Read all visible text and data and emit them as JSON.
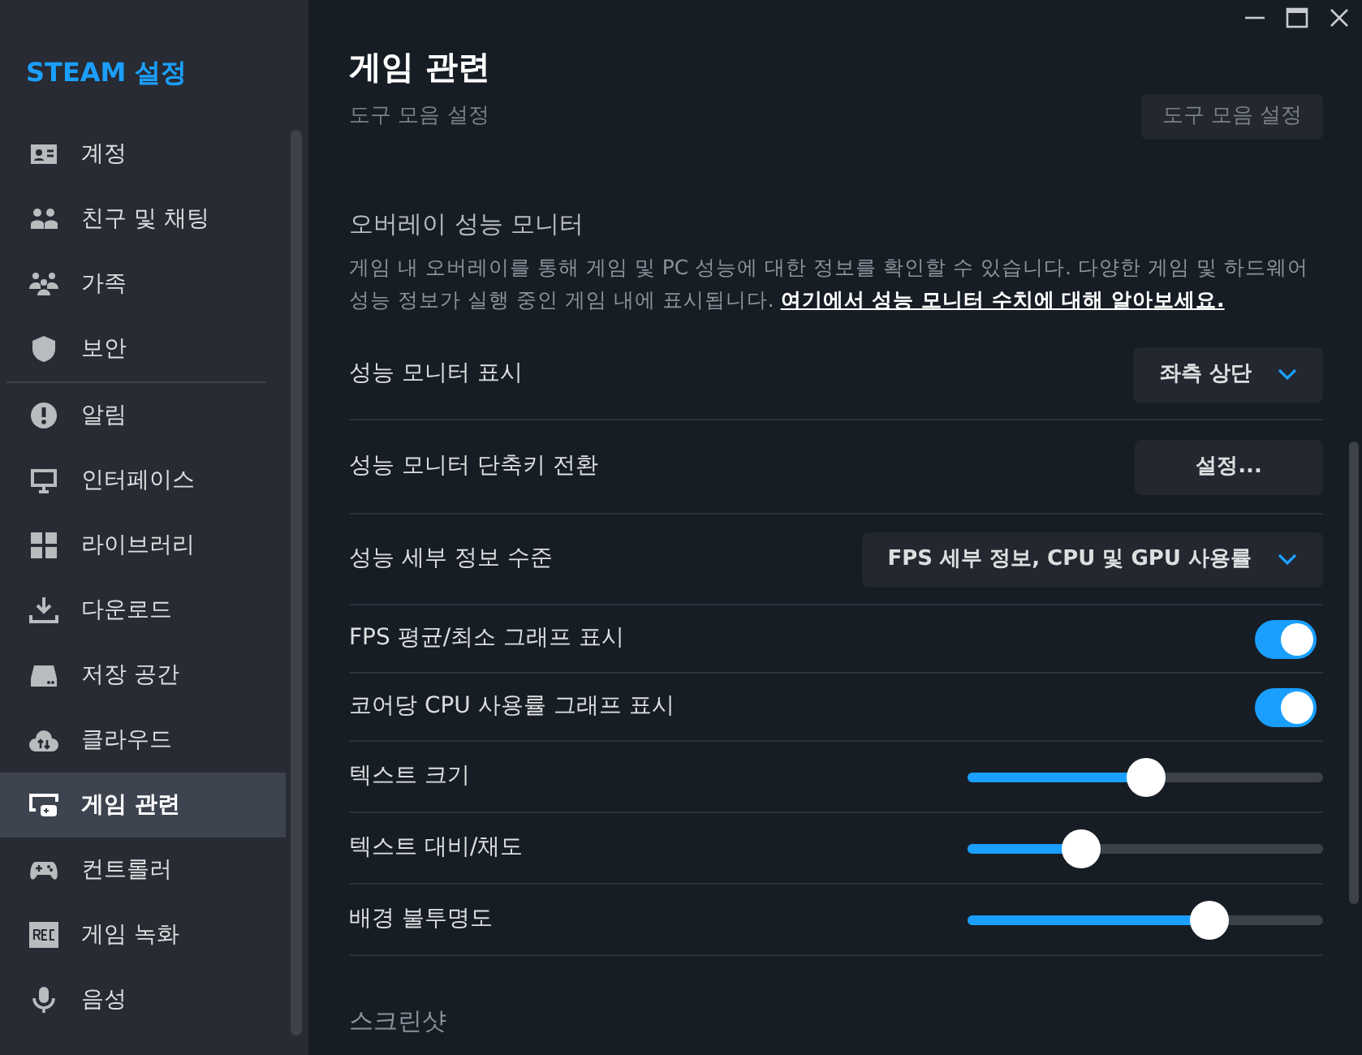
{
  "sidebar": {
    "title": "STEAM 설정",
    "groups": [
      [
        {
          "label": "계정",
          "selected": false
        },
        {
          "label": "친구 및 채팅",
          "selected": false
        },
        {
          "label": "가족",
          "selected": false
        },
        {
          "label": "보안",
          "selected": false
        }
      ],
      [
        {
          "label": "알림",
          "selected": false
        },
        {
          "label": "인터페이스",
          "selected": false
        },
        {
          "label": "라이브러리",
          "selected": false
        },
        {
          "label": "다운로드",
          "selected": false
        },
        {
          "label": "저장 공간",
          "selected": false
        },
        {
          "label": "클라우드",
          "selected": false
        },
        {
          "label": "게임 관련",
          "selected": true
        },
        {
          "label": "컨트롤러",
          "selected": false
        },
        {
          "label": "게임 녹화",
          "selected": false
        },
        {
          "label": "음성",
          "selected": false
        }
      ]
    ]
  },
  "page": {
    "title": "게임 관련",
    "faded_row": {
      "label": "도구 모음 설정",
      "button": "도구 모음 설정"
    },
    "section": {
      "title": "오버레이 성능 모니터",
      "description": "게임 내 오버레이를 통해 게임 및 PC 성능에 대한 정보를 확인할 수 있습니다. 다양한 게임 및 하드웨어 성능 정보가 실행 중인 게임 내에 표시됩니다.",
      "link": "여기에서 성능 모니터 수치에 대해 알아보세요."
    },
    "rows": [
      {
        "kind": "dropdown",
        "label": "성능 모니터 표시",
        "value": "좌측 상단"
      },
      {
        "kind": "button",
        "label": "성능 모니터 단축키 전환",
        "value": "설정..."
      },
      {
        "kind": "dropdown",
        "label": "성능 세부 정보 수준",
        "value": "FPS 세부 정보, CPU 및 GPU 사용률"
      },
      {
        "kind": "toggle",
        "label": "FPS 평균/최소 그래프 표시",
        "on": true
      },
      {
        "kind": "toggle",
        "label": "코어당 CPU 사용률 그래프 표시",
        "on": true
      },
      {
        "kind": "slider",
        "label": "텍스트 크기",
        "level": 0.5
      },
      {
        "kind": "slider",
        "label": "텍스트 대비/채도",
        "level": 0.32
      },
      {
        "kind": "slider",
        "label": "배경 불투명도",
        "level": 0.68
      }
    ],
    "next_section": "스크린샷"
  }
}
